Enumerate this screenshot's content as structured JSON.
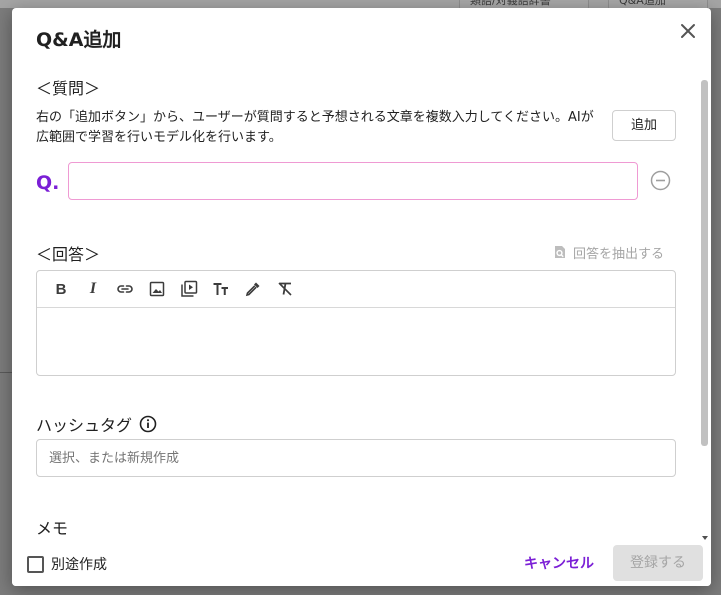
{
  "background": {
    "header_buttons": [
      "類語/対義語辞書",
      "Q&A追加"
    ]
  },
  "dialog": {
    "title": "Q&A追加",
    "close_icon": "close-icon"
  },
  "question_section": {
    "heading": "＜質問＞",
    "description": "右の「追加ボタン」から、ユーザーが質問すると予想される文章を複数入力してください。AIが広範囲で学習を行いモデル化を行います。",
    "add_button": "追加",
    "q_label": "Q.",
    "input_value": "",
    "remove_icon": "minus-circle-icon"
  },
  "answer_section": {
    "heading": "＜回答＞",
    "extract_button": "回答を抽出する",
    "toolbar": [
      "bold",
      "italic",
      "link",
      "image",
      "video",
      "text-size",
      "color-picker",
      "clear-format"
    ],
    "bold_glyph": "B",
    "italic_glyph": "I",
    "body_value": ""
  },
  "hashtag": {
    "label": "ハッシュタグ",
    "placeholder": "選択、または新規作成"
  },
  "memo": {
    "label": "メモ"
  },
  "footer": {
    "separate_label": "別途作成",
    "separate_checked": false,
    "cancel_label": "キャンセル",
    "submit_label": "登録する",
    "submit_enabled": false
  },
  "colors": {
    "accent": "#7b1fd6",
    "input_focus_border": "#ef9ad3",
    "disabled_bg": "#e0e0e0",
    "disabled_text": "#a5a5a5"
  }
}
